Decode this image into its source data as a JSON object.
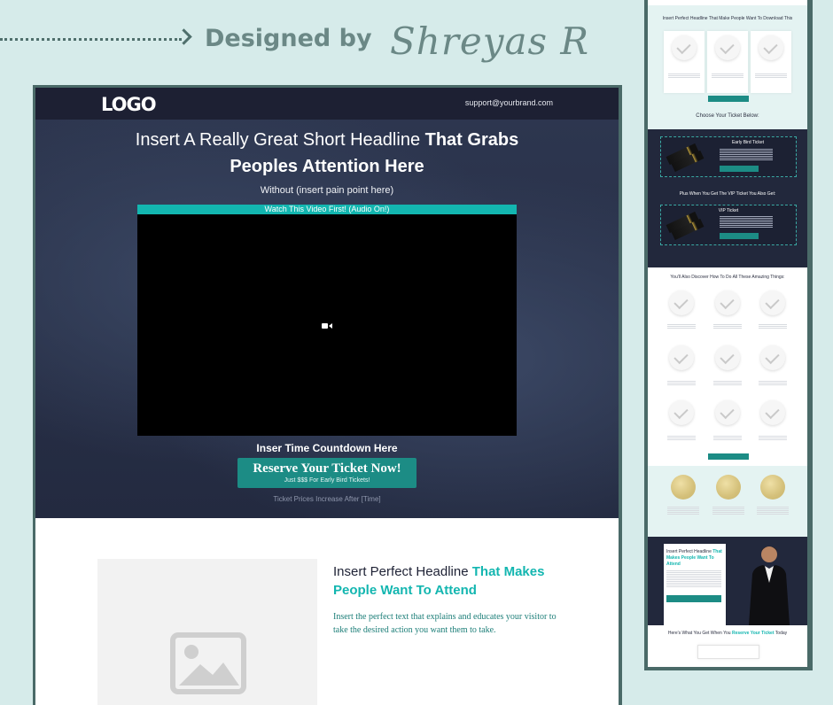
{
  "credit": {
    "designed_by": "Designed by",
    "signature": "Shreyas R"
  },
  "header": {
    "logo": "LOGO",
    "support_email": "support@yourbrand.com"
  },
  "hero": {
    "headline_regular": "Insert A Really Great Short Headline ",
    "headline_bold_1": "That Grabs",
    "headline_bold_2": "Peoples Attention Here",
    "subheadline": "Without (insert pain point here)",
    "video_bar": "Watch This Video First! (Audio On!)",
    "countdown": "Inser Time Countdown Here",
    "cta_main": "Reserve Your Ticket Now!",
    "cta_sub": "Just $$$ For Early Bird Tickets!",
    "price_note": "Ticket Prices Increase After [Time]"
  },
  "section2": {
    "headline_regular": "Insert Perfect Headline ",
    "headline_teal_1": "That Makes",
    "headline_teal_2": "People Want To Attend",
    "body": "Insert the perfect text that explains and educates your visitor to take the desired action you want them to take."
  },
  "preview": {
    "top_title": "Insert Perfect Headline That Make People Want To Download This",
    "choose_ticket": "Choose Your Ticket Below:",
    "early_bird": "Early Bird Ticket",
    "plus_when": "Plus When You Get The VIP Ticket You Also Get:",
    "vip": "VIP Ticket",
    "discover": "You'll Also Discover How To Do All These Amazing Things:",
    "bottom_headline_regular": "Insert Perfect Headline ",
    "bottom_headline_teal": "That Makes People Want To Attend",
    "heres_what_regular": "Here's What You Get When You ",
    "heres_what_teal": "Reserve Your Ticket",
    "heres_what_end": " Today"
  },
  "colors": {
    "accent": "#13b6b0",
    "button": "#1c8c85",
    "dark": "#1d2033",
    "frame": "#4a6a68",
    "background": "#d6ebea"
  }
}
